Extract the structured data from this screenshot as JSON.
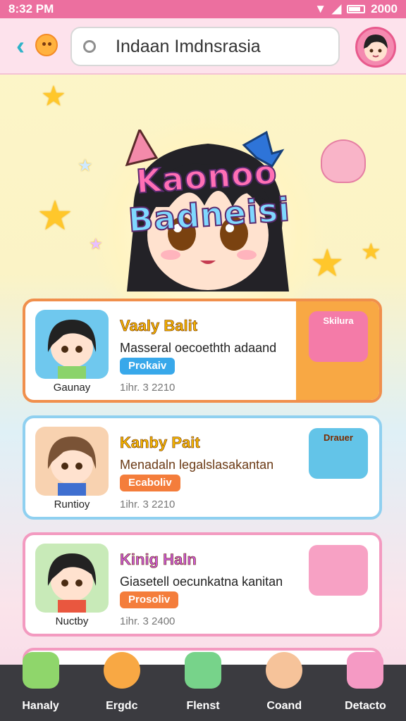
{
  "status": {
    "time": "8:32 PM",
    "battery": "2000"
  },
  "search": {
    "value": "Indaan Imdnsrasia"
  },
  "banner": {
    "title_part1": "Kaonoo ",
    "title_part2": "Badneisi"
  },
  "cards": [
    {
      "thumb_label": "Gaunay",
      "name": "Vaaly Balit",
      "desc": "Masseral oecoethth adaand",
      "button": "Prokaiv",
      "date": "1ihr. 3 2210",
      "sticker_text": "Skilura"
    },
    {
      "thumb_label": "Runtioy",
      "name": "Kanby Pait",
      "desc": "Menadaln legalslasakantan",
      "button": "Ecaboliv",
      "date": "1ihr. 3 2210",
      "sticker_text": "Drauer"
    },
    {
      "thumb_label": "Nuctby",
      "name": "Kinig Haln",
      "desc": "Giasetell oecunkatna kanitan",
      "button": "Prosoliv",
      "date": "1ihr. 3 2400",
      "sticker_text": ""
    }
  ],
  "nav": [
    {
      "label": "Hanaly"
    },
    {
      "label": "Ergdc"
    },
    {
      "label": "Flenst"
    },
    {
      "label": "Coand"
    },
    {
      "label": "Detacto"
    }
  ],
  "colors": {
    "accent": "#ec6f9f",
    "nav_bg": "#3b3b40"
  }
}
